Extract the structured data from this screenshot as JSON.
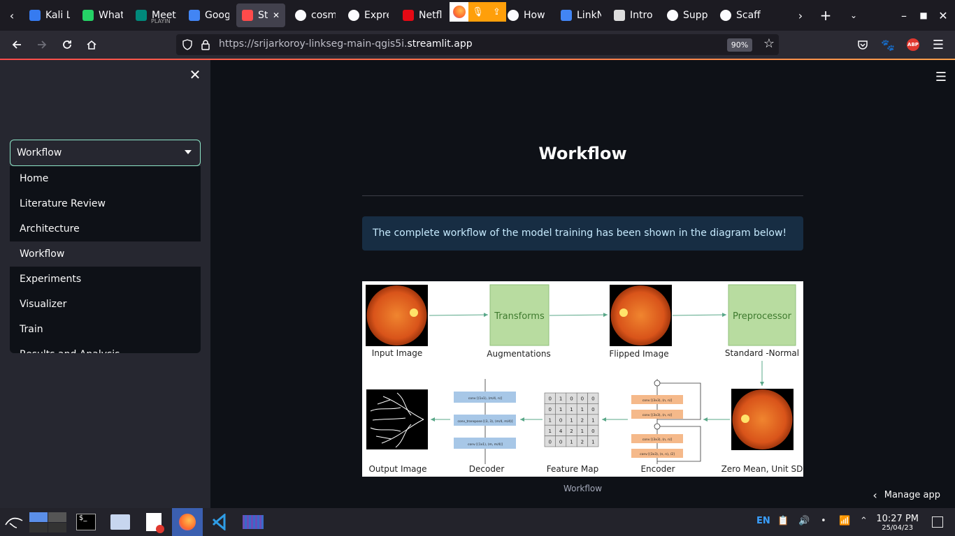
{
  "browser": {
    "tabs": [
      {
        "title": "Kali Linu",
        "icon": "kali-icon"
      },
      {
        "title": "What",
        "icon": "whatsapp-icon"
      },
      {
        "title": "Meet",
        "sub": "PLAYIN",
        "icon": "meet-icon"
      },
      {
        "title": "Goog",
        "icon": "google-icon"
      },
      {
        "title": "Stre",
        "icon": "streamlit-icon",
        "active": true
      },
      {
        "title": "cosm",
        "icon": "github-icon"
      },
      {
        "title": "Expre",
        "icon": "express-icon"
      },
      {
        "title": "Netfl",
        "icon": "netflix-icon"
      },
      {
        "title": "How",
        "icon": "github-icon"
      },
      {
        "title": "LinkN",
        "icon": "docs-icon"
      },
      {
        "title": "Intro",
        "icon": "gc-icon"
      },
      {
        "title": "Supp",
        "icon": "github-icon"
      },
      {
        "title": "Scaff",
        "icon": "github-icon"
      }
    ],
    "url_prefix": "https://srijarkoroy-linkseg-main-qgis5i.",
    "url_domain": "streamlit.app",
    "zoom": "90%",
    "abp": "ABP"
  },
  "sidebar": {
    "selected": "Workflow",
    "options": [
      "Home",
      "Literature Review",
      "Architecture",
      "Workflow",
      "Experiments",
      "Visualizer",
      "Train",
      "Results and Analysis"
    ]
  },
  "main": {
    "title": "Workflow",
    "info": "The complete workflow of the model training has been shown in the diagram below!",
    "caption": "Workflow",
    "manage": "Manage app"
  },
  "diagram": {
    "labels": {
      "input": "Input Image",
      "transforms": "Transforms",
      "augmentations": "Augmentations",
      "flipped": "Flipped Image",
      "preprocessor": "Preprocessor",
      "standard": "Standard -Normal",
      "output": "Output Image",
      "decoder": "Decoder",
      "feature": "Feature Map",
      "encoder": "Encoder",
      "zeromean": "Zero Mean, Unit SD"
    },
    "decoder_blocks": [
      "conv [(1x1), (m/4, n)]",
      "conv_transpose [(3, 3), (m/4, m/4)]",
      "conv [(1x1), (m, m/4)]"
    ],
    "encoder_blocks": [
      "conv [(3x3), (n, n)]",
      "conv [(3x3), (n, n)]",
      "conv [(3x3), (n, n)]",
      "conv [(3x3), (n, n), /2]"
    ],
    "feature_map": [
      [
        0,
        1,
        0,
        0,
        0
      ],
      [
        0,
        1,
        1,
        1,
        0
      ],
      [
        1,
        0,
        1,
        2,
        1
      ],
      [
        1,
        4,
        2,
        1,
        0
      ],
      [
        0,
        0,
        1,
        2,
        1
      ]
    ]
  },
  "taskbar": {
    "lang": "EN",
    "time": "10:27 PM",
    "date": "25/04/23"
  }
}
